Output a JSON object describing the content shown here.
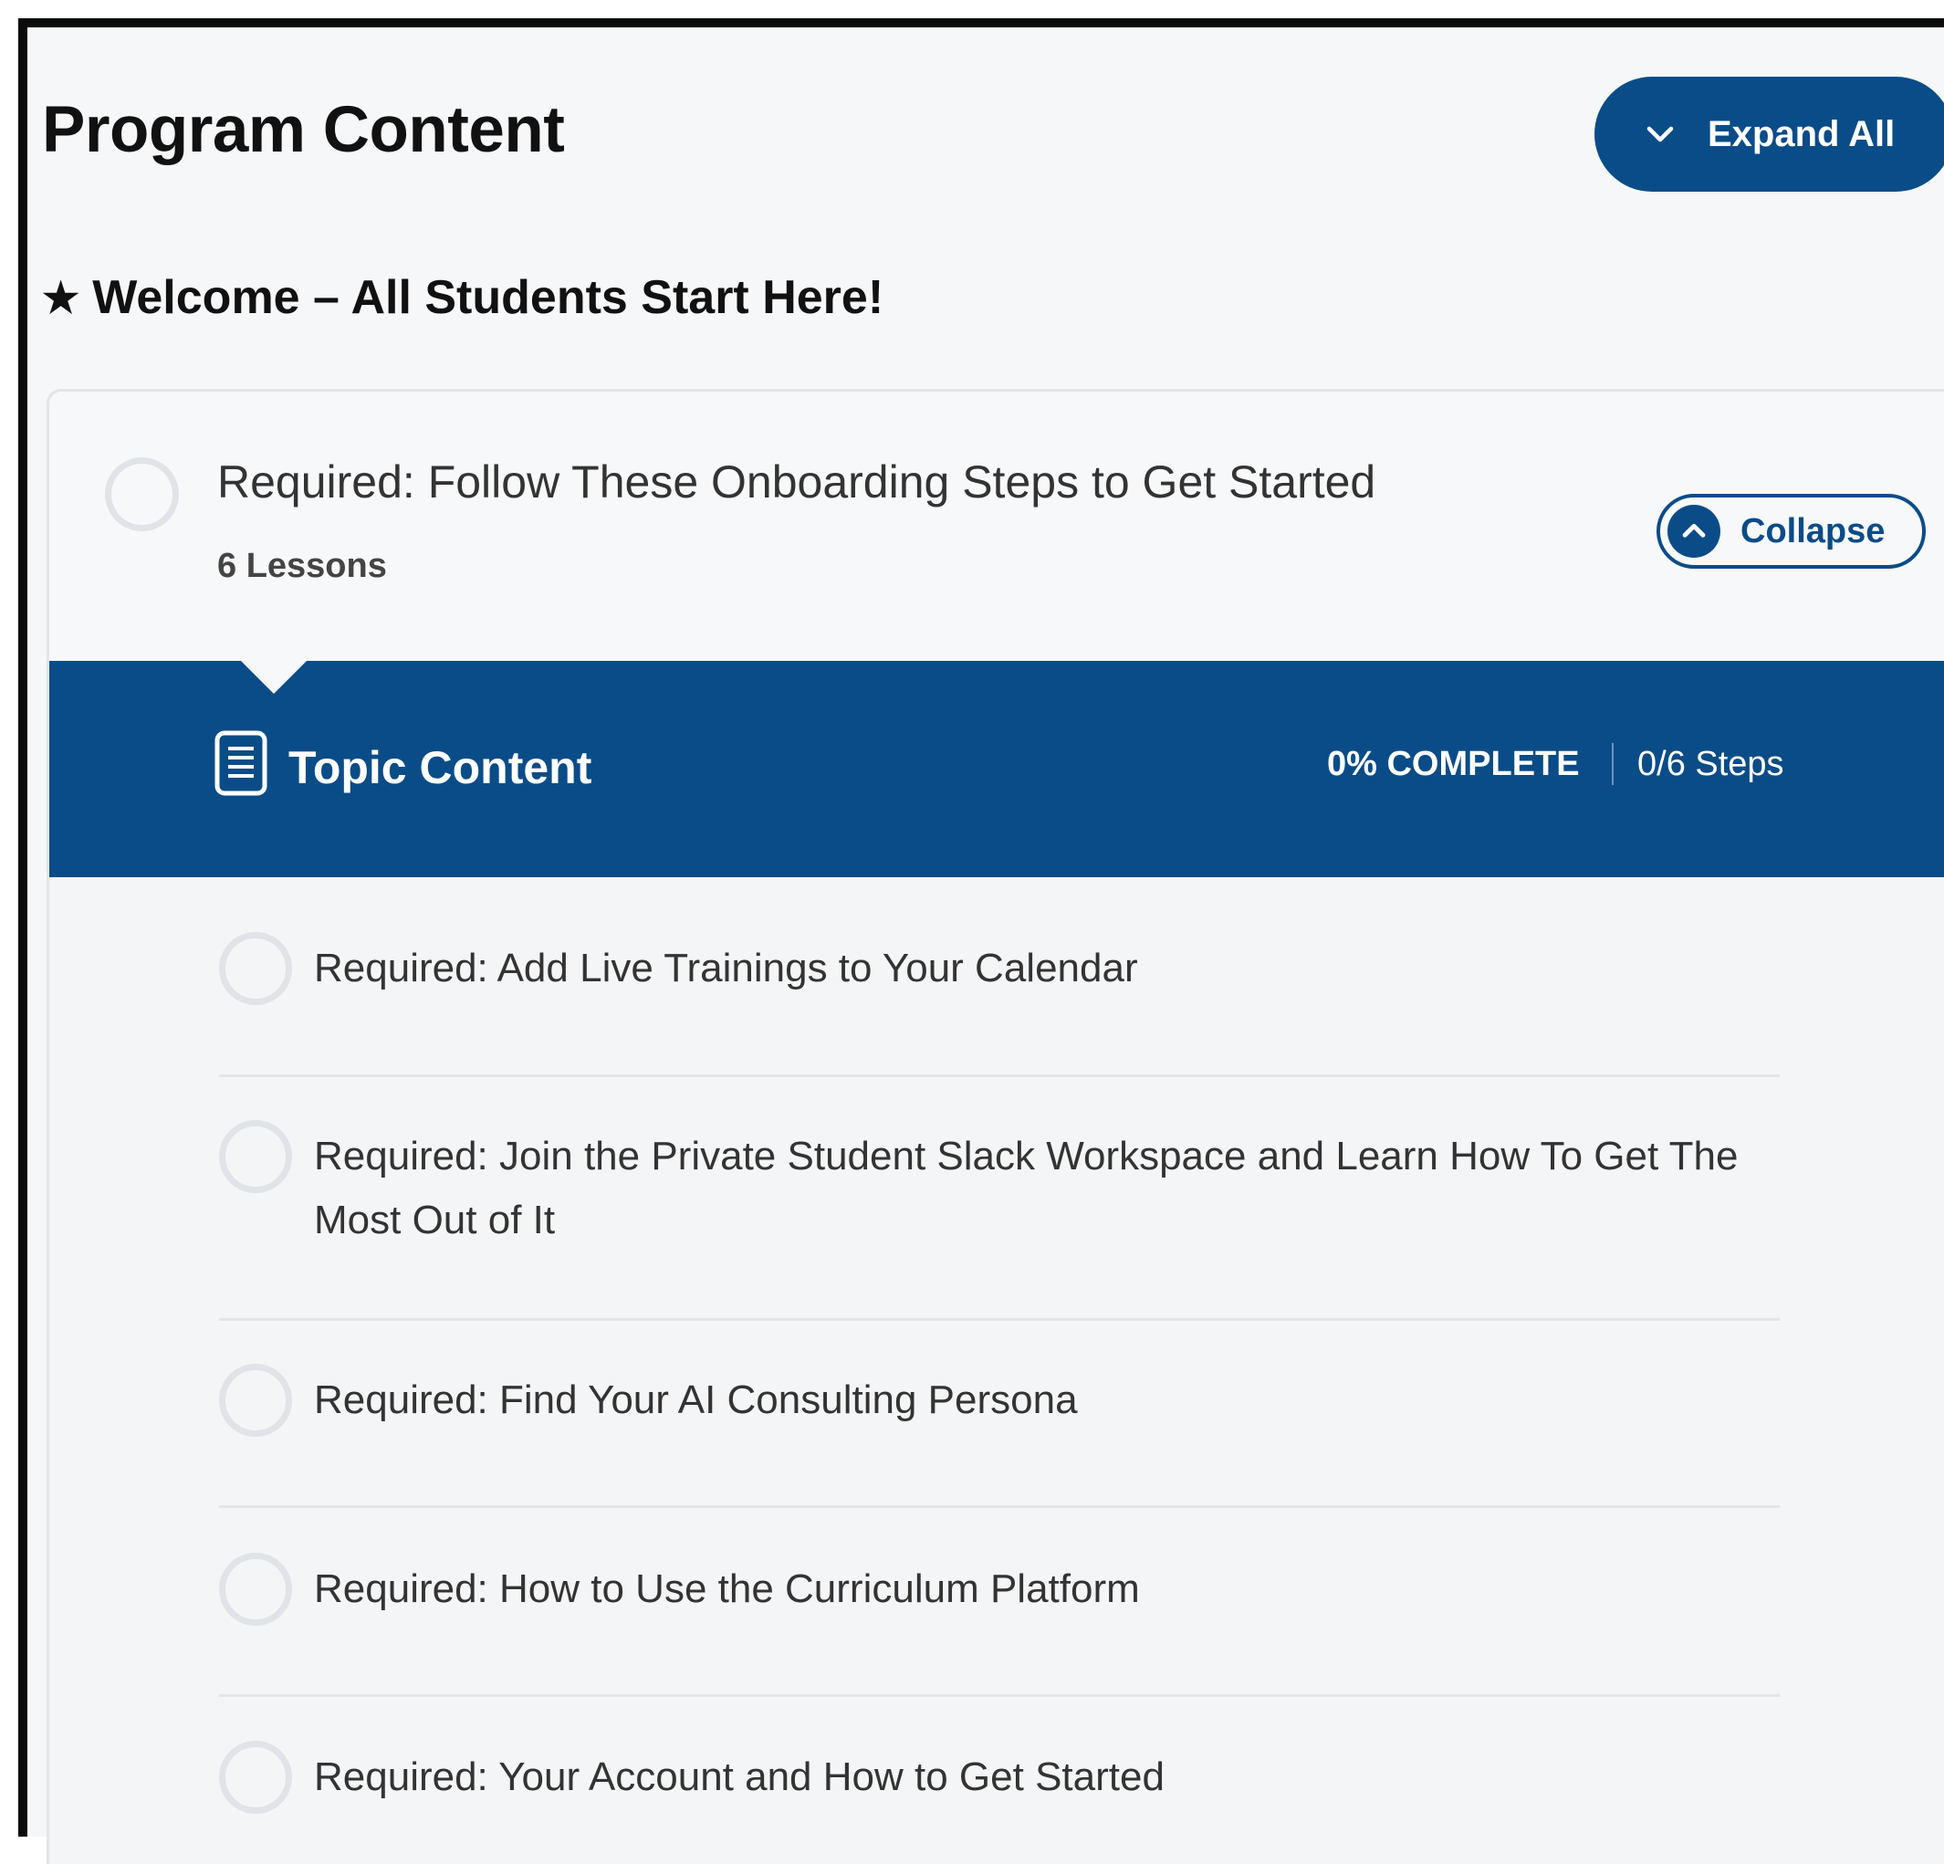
{
  "header": {
    "title": "Program Content",
    "expand_label": "Expand All"
  },
  "section": {
    "star": "★",
    "title": "Welcome – All Students Start Here!"
  },
  "topic": {
    "title": "Required: Follow These Onboarding Steps to Get Started",
    "count": "6 Lessons",
    "collapse_label": "Collapse"
  },
  "banner": {
    "title": "Topic Content",
    "progress": "0% COMPLETE",
    "steps": "0/6 Steps"
  },
  "lessons": [
    {
      "title": "Required: Add Live Trainings to Your Calendar"
    },
    {
      "title": "Required: Join the Private Student Slack Workspace and Learn How To Get The Most Out of It"
    },
    {
      "title": "Required: Find Your AI Consulting Persona"
    },
    {
      "title": "Required: How to Use the Curriculum Platform"
    },
    {
      "title": "Required: Your Account and How to Get Started"
    }
  ],
  "colors": {
    "brand_blue": "#0a4c87",
    "circle_border": "#e0e3e7"
  }
}
